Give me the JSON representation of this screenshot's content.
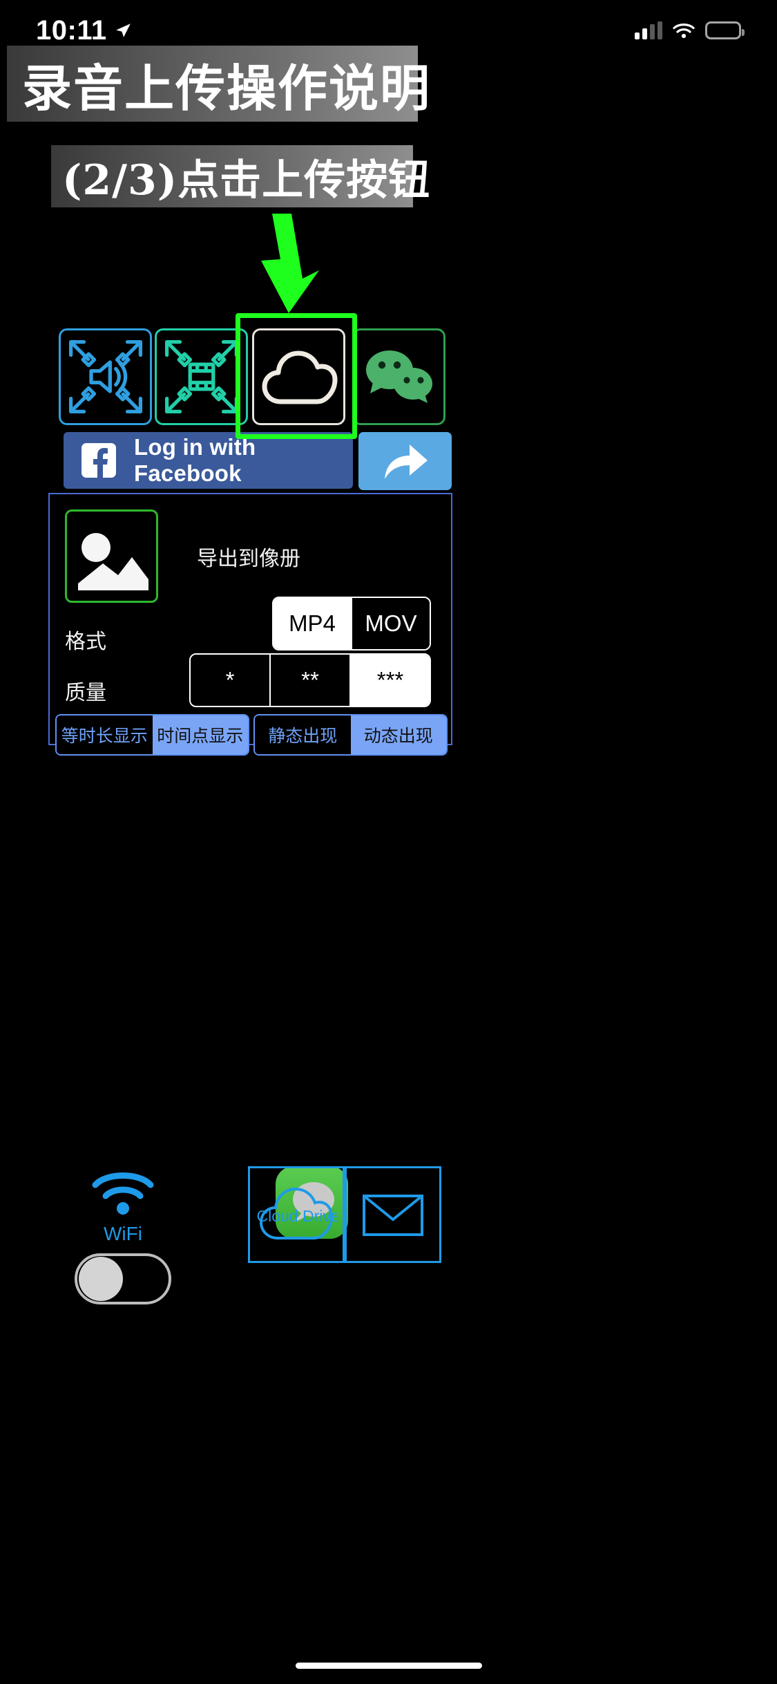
{
  "status_bar": {
    "time": "10:11",
    "location_icon": "location-arrow-icon",
    "signal_icon": "cellular-signal-icon",
    "wifi_icon": "wifi-icon",
    "battery_icon": "battery-icon"
  },
  "banners": {
    "title": "录音上传操作说明",
    "step": "(2/3)点击上传按钮"
  },
  "annotation": {
    "arrow_icon": "down-arrow-annotation",
    "arrow_color": "#1eff1e",
    "highlight_color": "#1eff1e",
    "highlight_target": "cloud-upload-tile"
  },
  "icon_row": {
    "items": [
      {
        "name": "audio-expand-tile",
        "icon": "speaker-expand-icon",
        "color": "#2f9fe0"
      },
      {
        "name": "video-expand-tile",
        "icon": "film-expand-icon",
        "color": "#21cfa8"
      },
      {
        "name": "cloud-upload-tile",
        "icon": "cloud-icon",
        "color": "#e8e4dd"
      },
      {
        "name": "wechat-tile",
        "icon": "wechat-icon",
        "color": "#2f9e4f"
      }
    ]
  },
  "facebook": {
    "label": "Log in with Facebook",
    "logo_icon": "facebook-f-icon",
    "bg_color": "#3b5a9b",
    "share_icon": "share-arrow-icon",
    "share_bg_color": "#5aa9e2"
  },
  "export_panel": {
    "photo_icon": "photo-image-icon",
    "export_label": "导出到像册",
    "format": {
      "label": "格式",
      "options": [
        "MP4",
        "MOV"
      ],
      "selected": "MP4"
    },
    "quality": {
      "label": "质量",
      "options": [
        "*",
        "**",
        "***"
      ],
      "selected": "***"
    },
    "display_mode": {
      "options": [
        "等时长显示",
        "时间点显示"
      ],
      "selected": "时间点显示"
    },
    "appearance_mode": {
      "options": [
        "静态出现",
        "动态出现"
      ],
      "selected": "动态出现"
    }
  },
  "services": {
    "wifi": {
      "label": "WiFi",
      "icon": "wifi-icon",
      "toggle_state": "off",
      "color": "#1f9ae8"
    },
    "messages": {
      "icon": "messages-bubble-icon",
      "color": "#4cc248"
    },
    "icloud": {
      "label": "iCloud Drive",
      "icon": "icloud-drive-icon",
      "color": "#1f9ae8"
    },
    "mail": {
      "icon": "mail-envelope-icon",
      "color": "#1f9ae8"
    }
  },
  "home_indicator": {
    "name": "home-indicator"
  }
}
